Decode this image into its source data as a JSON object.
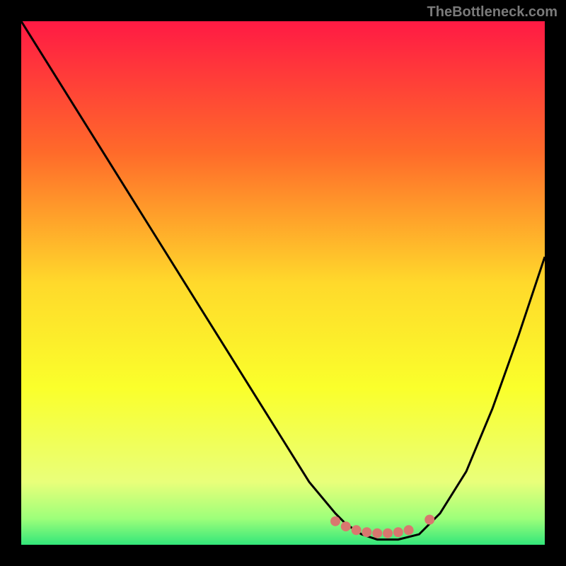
{
  "watermark": "TheBottleneck.com",
  "chart_data": {
    "type": "line",
    "title": "",
    "xlabel": "",
    "ylabel": "",
    "xlim": [
      0,
      100
    ],
    "ylim": [
      0,
      100
    ],
    "background_gradient": {
      "stops": [
        {
          "offset": 0.0,
          "color": "#ff1a44"
        },
        {
          "offset": 0.25,
          "color": "#ff6a2a"
        },
        {
          "offset": 0.5,
          "color": "#ffd92b"
        },
        {
          "offset": 0.7,
          "color": "#faff2b"
        },
        {
          "offset": 0.88,
          "color": "#e9ff7a"
        },
        {
          "offset": 0.95,
          "color": "#9dff7a"
        },
        {
          "offset": 1.0,
          "color": "#33e67a"
        }
      ]
    },
    "series": [
      {
        "name": "bottleneck-curve",
        "color": "#000000",
        "x": [
          0,
          5,
          10,
          15,
          20,
          25,
          30,
          35,
          40,
          45,
          50,
          55,
          60,
          62,
          65,
          68,
          72,
          76,
          80,
          85,
          90,
          95,
          100
        ],
        "y": [
          100,
          92,
          84,
          76,
          68,
          60,
          52,
          44,
          36,
          28,
          20,
          12,
          6,
          4,
          2,
          1,
          1,
          2,
          6,
          14,
          26,
          40,
          55
        ]
      }
    ],
    "markers": {
      "name": "optimal-range",
      "color": "#d9776f",
      "points": [
        {
          "x": 60,
          "y": 4.5
        },
        {
          "x": 62,
          "y": 3.5
        },
        {
          "x": 64,
          "y": 2.8
        },
        {
          "x": 66,
          "y": 2.4
        },
        {
          "x": 68,
          "y": 2.2
        },
        {
          "x": 70,
          "y": 2.2
        },
        {
          "x": 72,
          "y": 2.4
        },
        {
          "x": 74,
          "y": 2.8
        },
        {
          "x": 78,
          "y": 4.8
        }
      ]
    }
  }
}
